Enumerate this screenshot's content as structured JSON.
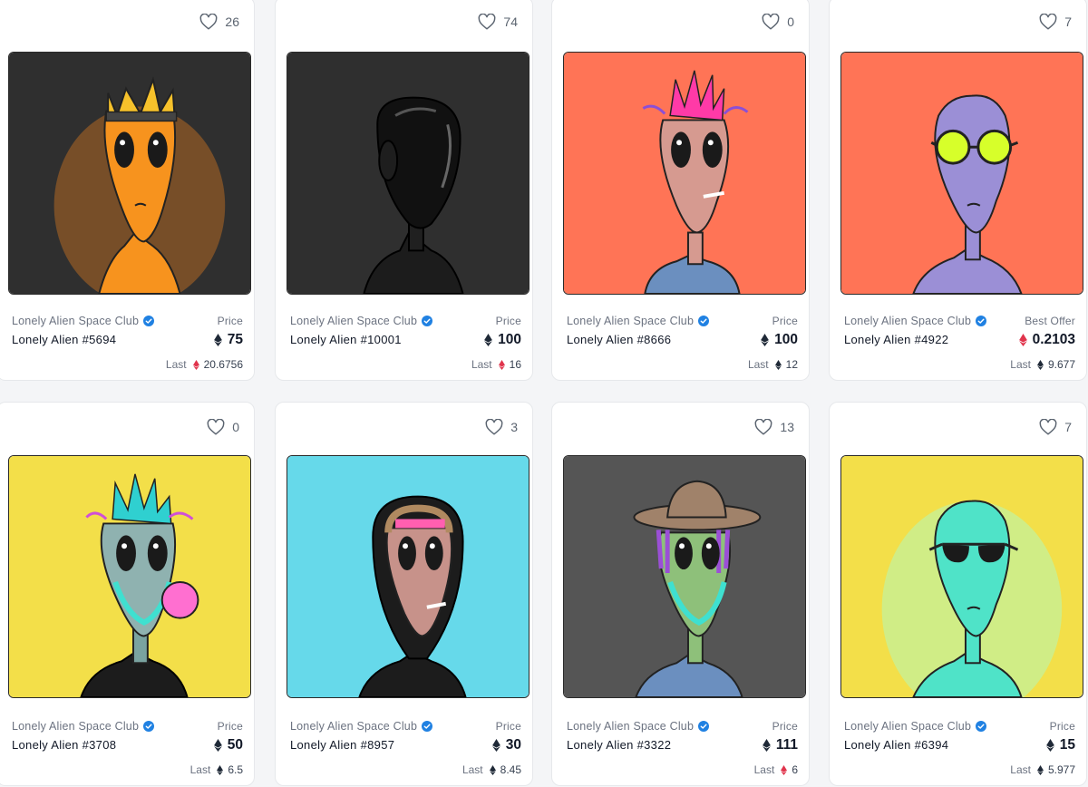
{
  "cards": [
    {
      "favorites": "26",
      "collection": "Lonely Alien Space Club",
      "name": "Lonely Alien #5694",
      "price_label": "Price",
      "price": "75",
      "price_currency": "eth-icon",
      "last_label": "Last",
      "last": "20.6756",
      "last_currency": "weth-icon",
      "bg": "#2f2f2f"
    },
    {
      "favorites": "74",
      "collection": "Lonely Alien Space Club",
      "name": "Lonely Alien #10001",
      "price_label": "Price",
      "price": "100",
      "price_currency": "eth-icon",
      "last_label": "Last",
      "last": "16",
      "last_currency": "weth-icon",
      "bg": "#2f2f2f"
    },
    {
      "favorites": "0",
      "collection": "Lonely Alien Space Club",
      "name": "Lonely Alien #8666",
      "price_label": "Price",
      "price": "100",
      "price_currency": "eth-icon",
      "last_label": "Last",
      "last": "12",
      "last_currency": "eth-icon",
      "bg": "#ff7456"
    },
    {
      "favorites": "7",
      "collection": "Lonely Alien Space Club",
      "name": "Lonely Alien #4922",
      "price_label": "Best Offer",
      "price": "0.2103",
      "price_currency": "weth-icon",
      "last_label": "Last",
      "last": "9.677",
      "last_currency": "eth-icon",
      "bg": "#ff7456"
    },
    {
      "favorites": "0",
      "collection": "Lonely Alien Space Club",
      "name": "Lonely Alien #3708",
      "price_label": "Price",
      "price": "50",
      "price_currency": "eth-icon",
      "last_label": "Last",
      "last": "6.5",
      "last_currency": "eth-icon",
      "bg": "#f3df49"
    },
    {
      "favorites": "3",
      "collection": "Lonely Alien Space Club",
      "name": "Lonely Alien #8957",
      "price_label": "Price",
      "price": "30",
      "price_currency": "eth-icon",
      "last_label": "Last",
      "last": "8.45",
      "last_currency": "eth-icon",
      "bg": "#66d9ea"
    },
    {
      "favorites": "13",
      "collection": "Lonely Alien Space Club",
      "name": "Lonely Alien #3322",
      "price_label": "Price",
      "price": "111",
      "price_currency": "eth-icon",
      "last_label": "Last",
      "last": "6",
      "last_currency": "weth-icon",
      "bg": "#555555"
    },
    {
      "favorites": "7",
      "collection": "Lonely Alien Space Club",
      "name": "Lonely Alien #6394",
      "price_label": "Price",
      "price": "15",
      "price_currency": "eth-icon",
      "last_label": "Last",
      "last": "5.977",
      "last_currency": "eth-icon",
      "bg": "#f3df49"
    }
  ],
  "colors": {
    "eth": "#1f2937",
    "weth": "#e0344c",
    "verified": "#2081e2"
  }
}
